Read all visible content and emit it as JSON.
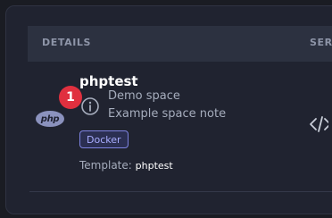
{
  "table": {
    "header": {
      "details": "DETAILS",
      "services": "SERV"
    }
  },
  "space": {
    "name": "phptest",
    "step_number": "1",
    "description_lines": [
      "Demo space",
      "Example space note"
    ],
    "tag": "Docker",
    "template_label": "Template:",
    "template_value": "phptest",
    "logo_text": "php"
  },
  "icons": {
    "info": "info-icon",
    "logo": "php-logo",
    "code": "code-icon"
  },
  "colors": {
    "step_badge": "#e0303f",
    "tag_border": "#7d82e0",
    "tag_text": "#a9adff"
  }
}
